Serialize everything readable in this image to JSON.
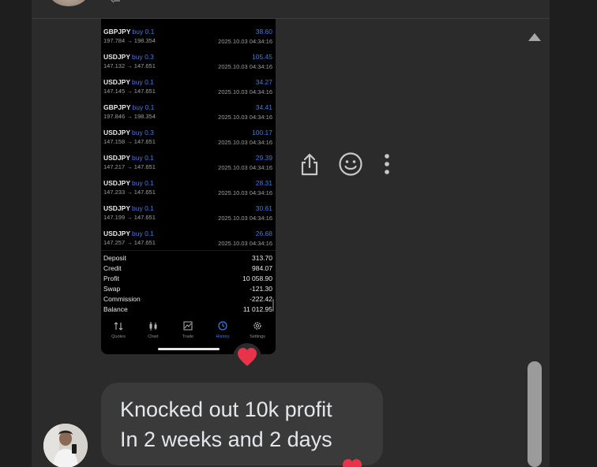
{
  "trades": [
    {
      "symbol": "GBPJPY",
      "side": "buy 0.1",
      "prices": "197.784 → 198.354",
      "profit": "38.60",
      "time": "2025.10.03 04:34:16"
    },
    {
      "symbol": "USDJPY",
      "side": "buy 0.3",
      "prices": "147.132 → 147.651",
      "profit": "105.45",
      "time": "2025.10.03 04:34:16"
    },
    {
      "symbol": "USDJPY",
      "side": "buy 0.1",
      "prices": "147.145 → 147.651",
      "profit": "34.27",
      "time": "2025.10.03 04:34:16"
    },
    {
      "symbol": "GBPJPY",
      "side": "buy 0.1",
      "prices": "197.846 → 198.354",
      "profit": "34.41",
      "time": "2025.10.03 04:34:16"
    },
    {
      "symbol": "USDJPY",
      "side": "buy 0.3",
      "prices": "147.158 → 147.651",
      "profit": "100.17",
      "time": "2025.10.03 04:34:16"
    },
    {
      "symbol": "USDJPY",
      "side": "buy 0.1",
      "prices": "147.217 → 147.651",
      "profit": "29.39",
      "time": "2025.10.03 04:34:16"
    },
    {
      "symbol": "USDJPY",
      "side": "buy 0.1",
      "prices": "147.233 → 147.651",
      "profit": "28.31",
      "time": "2025.10.03 04:34:16"
    },
    {
      "symbol": "USDJPY",
      "side": "buy 0.1",
      "prices": "147.199 → 147.651",
      "profit": "30.61",
      "time": "2025.10.03 04:34:16"
    },
    {
      "symbol": "USDJPY",
      "side": "buy 0.1",
      "prices": "147.257 → 147.651",
      "profit": "26.68",
      "time": "2025.10.03 04:34:16"
    }
  ],
  "summary": [
    {
      "label": "Deposit",
      "value": "313.70"
    },
    {
      "label": "Credit",
      "value": "984.07"
    },
    {
      "label": "Profit",
      "value": "10 058.90"
    },
    {
      "label": "Swap",
      "value": "-121.30"
    },
    {
      "label": "Commission",
      "value": "-222.42"
    },
    {
      "label": "Balance",
      "value": "11 012.95"
    }
  ],
  "tabs": [
    {
      "label": "Quotes",
      "icon": "quotes-icon"
    },
    {
      "label": "Chart",
      "icon": "chart-icon"
    },
    {
      "label": "Trade",
      "icon": "trade-icon"
    },
    {
      "label": "History",
      "icon": "history-icon",
      "active": true
    },
    {
      "label": "Settings",
      "icon": "settings-icon"
    }
  ],
  "message": {
    "line1": "Knocked out 10k profit",
    "line2": "In 2 weeks and 2 days"
  },
  "reaction": "heart",
  "colors": {
    "accent": "#3d7be0",
    "heart": "#e8334a",
    "panel": "#2b2b2b",
    "bubble": "#3a3a3a"
  }
}
